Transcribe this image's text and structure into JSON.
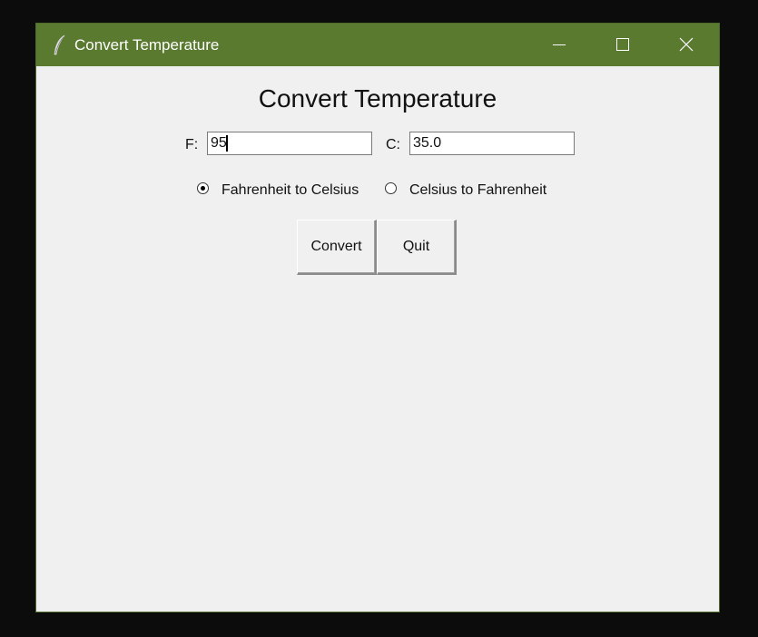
{
  "window": {
    "title": "Convert Temperature",
    "titlebar_color": "#5a7a30",
    "background_color": "#f0f0f0"
  },
  "titlebar": {
    "icons": [
      "feather-icon",
      "minimize-icon",
      "maximize-icon",
      "close-icon"
    ]
  },
  "main": {
    "heading": "Convert Temperature",
    "fahrenheit": {
      "label": "F:",
      "value": "95"
    },
    "celsius": {
      "label": "C:",
      "value": "35.0"
    },
    "radios": [
      {
        "label": "Fahrenheit to Celsius",
        "selected": true
      },
      {
        "label": "Celsius to Fahrenheit",
        "selected": false
      }
    ],
    "buttons": {
      "convert": "Convert",
      "quit": "Quit"
    }
  }
}
